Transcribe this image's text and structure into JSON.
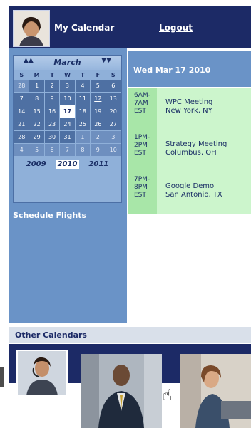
{
  "header": {
    "title": "My Calendar",
    "logout": "Logout"
  },
  "calendar": {
    "month": "March",
    "prev": "▲▲",
    "next": "▼▼",
    "weekdays": [
      "S",
      "M",
      "T",
      "W",
      "T",
      "F",
      "S"
    ],
    "weeks": [
      [
        "28",
        "1",
        "2",
        "3",
        "4",
        "5",
        "6"
      ],
      [
        "7",
        "8",
        "9",
        "10",
        "11",
        "12",
        "13"
      ],
      [
        "14",
        "15",
        "16",
        "17",
        "18",
        "19",
        "20"
      ],
      [
        "21",
        "22",
        "23",
        "24",
        "25",
        "26",
        "27"
      ],
      [
        "28",
        "29",
        "30",
        "31",
        "1",
        "2",
        "3"
      ],
      [
        "4",
        "5",
        "6",
        "7",
        "8",
        "9",
        "10"
      ]
    ],
    "today": "17",
    "years": [
      "2009",
      "2010",
      "2011"
    ],
    "selected_year": "2010"
  },
  "sidebar": {
    "schedule_flights": "Schedule Flights"
  },
  "events": {
    "date_header": "Wed Mar 17 2010",
    "items": [
      {
        "time": "6AM-\n7AM\nEST",
        "title": "WPC Meeting",
        "location": "New York, NY"
      },
      {
        "time": "1PM-\n2PM\nEST",
        "title": "Strategy Meeting",
        "location": "Columbus, OH"
      },
      {
        "time": "7PM-\n8PM\nEST",
        "title": "Google Demo",
        "location": "San Antonio, TX"
      }
    ]
  },
  "other_calendars": {
    "title": "Other Calendars"
  },
  "colors": {
    "navy": "#1c2a66",
    "sidebar": "#6a93c7",
    "event_green": "#ccf5cc"
  }
}
